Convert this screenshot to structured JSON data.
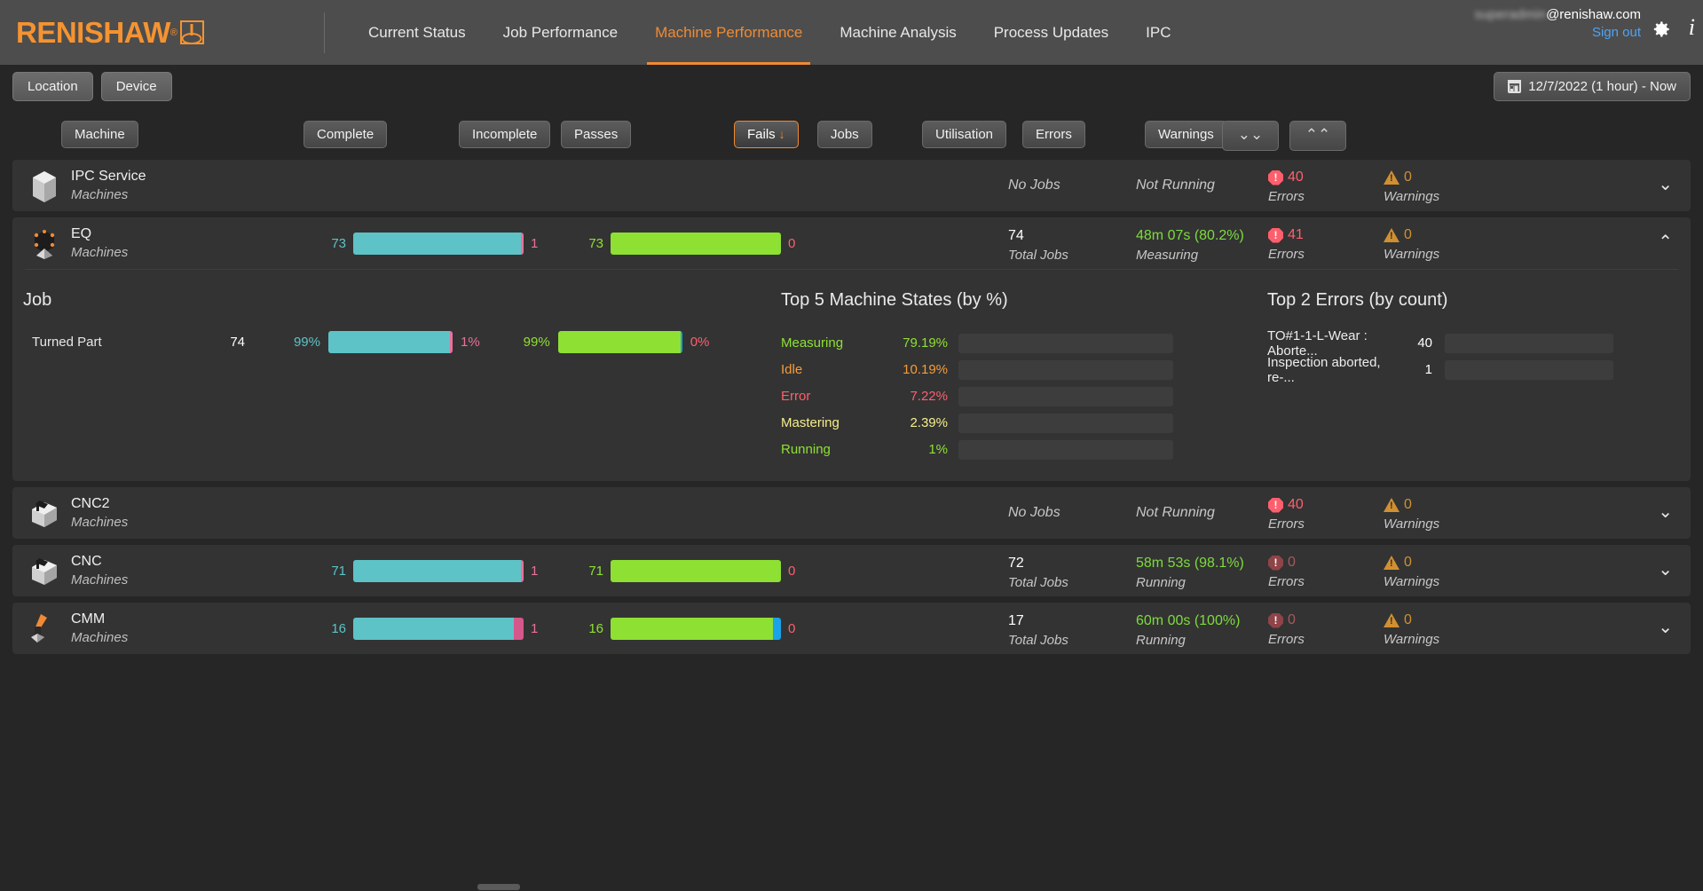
{
  "header": {
    "logo_text": "RENISHAW",
    "logo_registered": "®",
    "nav": [
      {
        "label": "Current Status",
        "active": false
      },
      {
        "label": "Job Performance",
        "active": false
      },
      {
        "label": "Machine Performance",
        "active": true
      },
      {
        "label": "Machine Analysis",
        "active": false
      },
      {
        "label": "Process Updates",
        "active": false
      },
      {
        "label": "IPC",
        "active": false
      }
    ],
    "user_name_redacted": "superadmin",
    "user_domain": "@renishaw.com",
    "signout_label": "Sign out",
    "gear_icon": "gear-icon",
    "info_icon": "info-icon"
  },
  "filterbar": {
    "location_label": "Location",
    "device_label": "Device",
    "daterange_label": "12/7/2022 (1 hour) - Now",
    "calendar_icon": "calendar-icon"
  },
  "columns": {
    "machine": "Machine",
    "complete": "Complete",
    "incomplete": "Incomplete",
    "passes": "Passes",
    "fails": "Fails",
    "fails_sort": "↓",
    "jobs": "Jobs",
    "utilisation": "Utilisation",
    "errors": "Errors",
    "warnings": "Warnings",
    "collapse_all": "⌄⌄",
    "expand_all": "⌃⌃"
  },
  "accent": {
    "orange": "#f08a33",
    "teal": "#5dc3c6",
    "green": "#8ee032",
    "pink": "#e8719c",
    "red": "#ff5f6d",
    "blue": "#1aa3e8",
    "amber": "#f79c38",
    "yellow": "#f5ee8d"
  },
  "rows": [
    {
      "name": "IPC Service",
      "subtitle": "Machines",
      "icon": "machine-ipc-icon",
      "has_bars": false,
      "jobs_text": "No Jobs",
      "util_text": "Not Running",
      "errors": "40",
      "errors_label": "Errors",
      "errors_zero": false,
      "warnings": "0",
      "warnings_label": "Warnings",
      "expanded": false,
      "chevron": "⌄"
    },
    {
      "name": "EQ",
      "subtitle": "Machines",
      "icon": "machine-eq-icon",
      "has_bars": true,
      "complete": "73",
      "incomplete": "1",
      "complete_pct": 98.6,
      "passes": "73",
      "fails": "0",
      "passes_pct": 99.0,
      "jobs_text": "74",
      "jobs_label": "Total Jobs",
      "util_text": "48m 07s (80.2%)",
      "util_label": "Measuring",
      "errors": "41",
      "errors_label": "Errors",
      "errors_zero": false,
      "warnings": "0",
      "warnings_label": "Warnings",
      "expanded": true,
      "chevron": "⌃"
    },
    {
      "name": "CNC2",
      "subtitle": "Machines",
      "icon": "machine-cnc-icon",
      "has_bars": false,
      "jobs_text": "No Jobs",
      "util_text": "Not Running",
      "errors": "40",
      "errors_label": "Errors",
      "errors_zero": false,
      "warnings": "0",
      "warnings_label": "Warnings",
      "expanded": false,
      "chevron": "⌄"
    },
    {
      "name": "CNC",
      "subtitle": "Machines",
      "icon": "machine-cnc-icon",
      "has_bars": true,
      "complete": "71",
      "incomplete": "1",
      "complete_pct": 98.6,
      "passes": "71",
      "fails": "0",
      "passes_pct": 99.0,
      "jobs_text": "72",
      "jobs_label": "Total Jobs",
      "util_text": "58m 53s (98.1%)",
      "util_label": "Running",
      "errors": "0",
      "errors_label": "Errors",
      "errors_zero": true,
      "warnings": "0",
      "warnings_label": "Warnings",
      "expanded": false,
      "chevron": "⌄"
    },
    {
      "name": "CMM",
      "subtitle": "Machines",
      "icon": "machine-cmm-icon",
      "has_bars": true,
      "complete": "16",
      "incomplete": "1",
      "complete_pct": 94.1,
      "passes": "16",
      "fails": "0",
      "passes_pct": 95.5,
      "jobs_text": "17",
      "jobs_label": "Total Jobs",
      "util_text": "60m 00s (100%)",
      "util_label": "Running",
      "errors": "0",
      "errors_label": "Errors",
      "errors_zero": true,
      "warnings": "0",
      "warnings_label": "Warnings",
      "expanded": false,
      "chevron": "⌄"
    }
  ],
  "detail": {
    "job_panel": {
      "title": "Job",
      "jobs": [
        {
          "name": "Turned Part",
          "count": "74",
          "complete_pct_label": "99%",
          "incomplete_pct_label": "1%",
          "complete_pct": 99,
          "passes_pct_label": "99%",
          "fails_pct_label": "0%",
          "passes_pct": 99
        }
      ]
    },
    "states_panel": {
      "title": "Top 5 Machine States (by %)",
      "states": [
        {
          "name": "Measuring",
          "pct_label": "79.19%",
          "pct": 79.19,
          "color": "#8ee032"
        },
        {
          "name": "Idle",
          "pct_label": "10.19%",
          "pct": 10.19,
          "color": "#f79c38"
        },
        {
          "name": "Error",
          "pct_label": "7.22%",
          "pct": 7.22,
          "color": "#ff5f6d"
        },
        {
          "name": "Mastering",
          "pct_label": "2.39%",
          "pct": 2.39,
          "color": "#f5ee8d"
        },
        {
          "name": "Running",
          "pct_label": "1%",
          "pct": 1.0,
          "color": "#8ee032"
        }
      ]
    },
    "errors_panel": {
      "title": "Top 2 Errors (by count)",
      "errors": [
        {
          "name": "TO#1-1-L-Wear : Aborte...",
          "count": "40",
          "pct": 100
        },
        {
          "name": "Inspection aborted, re-...",
          "count": "1",
          "pct": 2.5
        }
      ]
    }
  },
  "chart_data": {
    "type": "bar",
    "title": "Top 5 Machine States (by %)",
    "categories": [
      "Measuring",
      "Idle",
      "Error",
      "Mastering",
      "Running"
    ],
    "values": [
      79.19,
      10.19,
      7.22,
      2.39,
      1.0
    ],
    "ylabel": "%",
    "ylim": [
      0,
      100
    ]
  }
}
